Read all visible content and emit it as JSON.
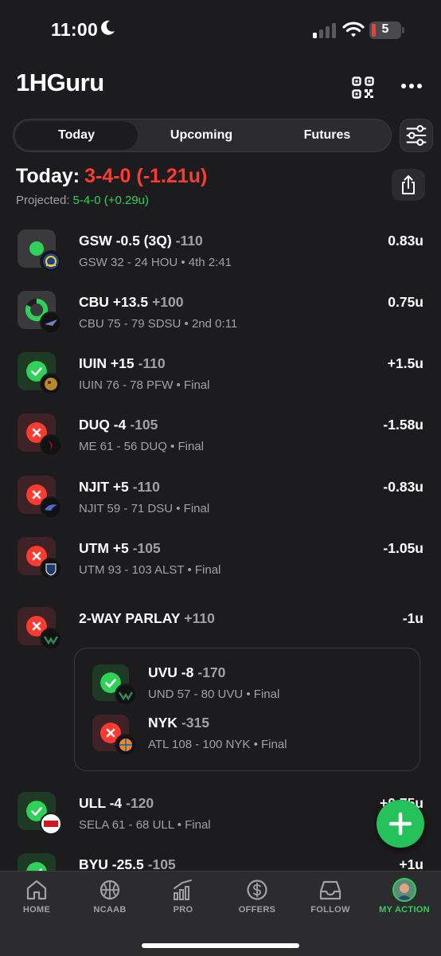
{
  "status_bar": {
    "time": "11:00",
    "battery": "5"
  },
  "header": {
    "title": "1HGuru",
    "qr_icon": "qr-code-icon",
    "more_icon": "more-icon"
  },
  "tabs": [
    {
      "label": "Today",
      "active": true
    },
    {
      "label": "Upcoming",
      "active": false
    },
    {
      "label": "Futures",
      "active": false
    }
  ],
  "summary": {
    "today_label": "Today:",
    "today_record": "3-4-0 (-1.21u)",
    "projected_label": "Projected:",
    "projected_value": "5-4-0 (+0.29u)"
  },
  "bets": [
    {
      "title": "GSW -0.5 (3Q)",
      "odds": "-110",
      "sub": "GSW 32 - 24 HOU • 4th 2:41",
      "units": "0.83u",
      "status": "pending"
    },
    {
      "title": "CBU +13.5",
      "odds": "+100",
      "sub": "CBU 75 - 79 SDSU • 2nd 0:11",
      "units": "0.75u",
      "status": "pending"
    },
    {
      "title": "IUIN +15",
      "odds": "-110",
      "sub": "IUIN 76 - 78 PFW • Final",
      "units": "+1.5u",
      "status": "won"
    },
    {
      "title": "DUQ -4",
      "odds": "-105",
      "sub": "ME 61 - 56 DUQ • Final",
      "units": "-1.58u",
      "status": "lost"
    },
    {
      "title": "NJIT +5",
      "odds": "-110",
      "sub": "NJIT 59 - 71 DSU • Final",
      "units": "-0.83u",
      "status": "lost"
    },
    {
      "title": "UTM +5",
      "odds": "-105",
      "sub": "UTM 93 - 103 ALST • Final",
      "units": "-1.05u",
      "status": "lost"
    },
    {
      "title": "2-WAY PARLAY",
      "odds": "+110",
      "sub": "",
      "units": "-1u",
      "status": "lost"
    }
  ],
  "parlay_legs": [
    {
      "title": "UVU -8",
      "odds": "-170",
      "sub": "UND 57 - 80 UVU • Final",
      "status": "won"
    },
    {
      "title": "NYK",
      "odds": "-315",
      "sub": "ATL 108 - 100 NYK • Final",
      "status": "lost"
    }
  ],
  "bets_after": [
    {
      "title": "ULL -4",
      "odds": "-120",
      "sub": "SELA 61 - 68 ULL • Final",
      "units": "+0.75u",
      "status": "won",
      "logo_text": "RAGIN' CAJUNS"
    },
    {
      "title": "BYU -25.5",
      "odds": "-105",
      "sub": "",
      "units": "+1u",
      "status": "won"
    }
  ],
  "nav": [
    {
      "label": "HOME",
      "icon": "home-icon"
    },
    {
      "label": "NCAAB",
      "icon": "basketball-icon"
    },
    {
      "label": "PRO",
      "icon": "chart-icon"
    },
    {
      "label": "OFFERS",
      "icon": "dollar-icon"
    },
    {
      "label": "FOLLOW",
      "icon": "inbox-icon"
    },
    {
      "label": "MY ACTION",
      "icon": "avatar",
      "active": true
    }
  ],
  "colors": {
    "background": "#1c1c1e",
    "win": "#30d158",
    "loss": "#ff3b30",
    "fab": "#25c15a"
  }
}
